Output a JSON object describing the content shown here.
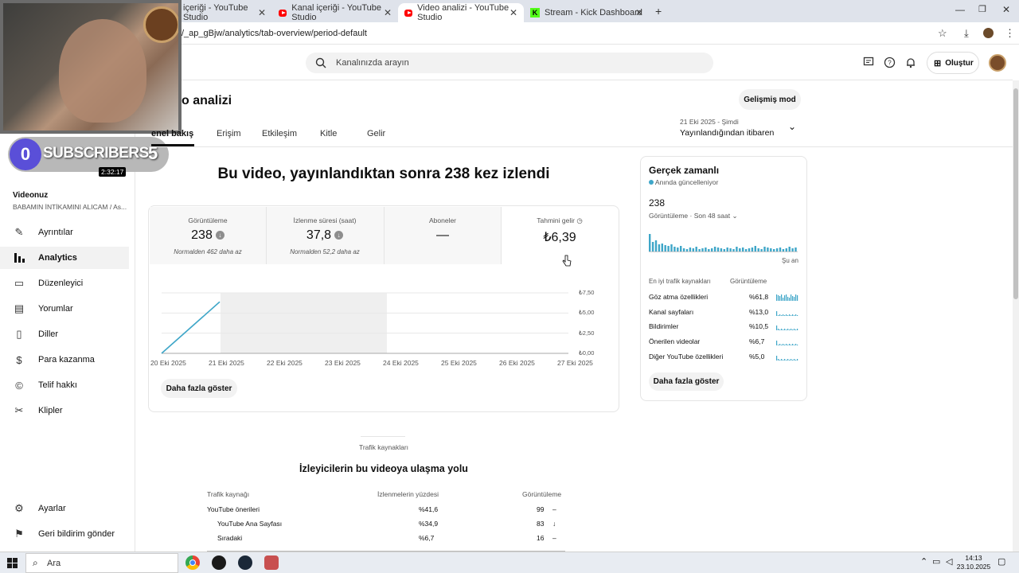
{
  "browser": {
    "tabs": [
      {
        "label": "içeriği - YouTube Studio"
      },
      {
        "label": "Kanal içeriği - YouTube Studio"
      },
      {
        "label": "Video analizi - YouTube Studio"
      },
      {
        "label": "Stream - Kick Dashboard"
      }
    ],
    "url": "/_ap_gBjw/analytics/tab-overview/period-default"
  },
  "header": {
    "search_placeholder": "Kanalınızda arayın",
    "create_label": "Oluştur"
  },
  "overlay": {
    "subscribers_left": "0",
    "subscribers_text": "SUBSCRIBERS",
    "subscribers_right": "5",
    "video_duration": "2:32:17"
  },
  "sidebar": {
    "your_video": "Videonuz",
    "video_title": "BABAMIN İNTİKAMINI ALICAM / As...",
    "items": [
      {
        "label": "Ayrıntılar",
        "icon": "pencil-icon"
      },
      {
        "label": "Analytics",
        "icon": "analytics-icon"
      },
      {
        "label": "Düzenleyici",
        "icon": "editor-icon"
      },
      {
        "label": "Yorumlar",
        "icon": "comments-icon"
      },
      {
        "label": "Diller",
        "icon": "languages-icon"
      },
      {
        "label": "Para kazanma",
        "icon": "dollar-icon"
      },
      {
        "label": "Telif hakkı",
        "icon": "copyright-icon"
      },
      {
        "label": "Klipler",
        "icon": "scissors-icon"
      }
    ],
    "settings": "Ayarlar",
    "feedback": "Geri bildirim gönder"
  },
  "page": {
    "title": "o analizi",
    "advanced_mode": "Gelişmiş mod",
    "tabs": [
      "enel bakış",
      "Erişim",
      "Etkileşim",
      "Kitle",
      "Gelir"
    ],
    "date_range_top": "21 Eki 2025 - Şimdi",
    "date_range_bottom": "Yayınlandığından itibaren",
    "headline": "Bu video, yayınlandıktan sonra 238 kez izlendi",
    "show_more": "Daha fazla göster"
  },
  "metrics": [
    {
      "title": "Görüntüleme",
      "value": "238",
      "sub": "Normalden 462 daha az"
    },
    {
      "title": "İzlenme süresi (saat)",
      "value": "37,8",
      "sub": "Normalden 52,2 daha az"
    },
    {
      "title": "Aboneler",
      "value": "—",
      "sub": ""
    },
    {
      "title": "Tahmini gelir",
      "value": "₺6,39",
      "sub": ""
    }
  ],
  "chart_data": {
    "type": "line",
    "x": [
      "20 Eki 2025",
      "21 Eki 2025",
      "22 Eki 2025",
      "23 Eki 2025",
      "24 Eki 2025",
      "25 Eki 2025",
      "26 Eki 2025",
      "27 Eki 2025"
    ],
    "series": [
      {
        "values": [
          0,
          6.39
        ]
      }
    ],
    "x_points": [
      "20 Eki 2025",
      "21 Eki 2025"
    ],
    "y_ticks": [
      "₺7,50",
      "₺5,00",
      "₺2,50",
      "₺0,00"
    ],
    "ylim": [
      0,
      7.5
    ],
    "highlight_range": [
      "21 Eki 2025",
      "24 Eki 2025"
    ],
    "color": "#3ea6c8"
  },
  "realtime": {
    "title": "Gerçek zamanlı",
    "subtitle": "Anında güncelleniyor",
    "value": "238",
    "caption": "Görüntüleme · Son 48 saat",
    "now_label": "Şu an",
    "sources_header_left": "En iyi trafik kaynakları",
    "sources_header_right": "Görüntüleme",
    "sources": [
      {
        "name": "Göz atma özellikleri",
        "pct": "%61,8"
      },
      {
        "name": "Kanal sayfaları",
        "pct": "%13,0"
      },
      {
        "name": "Bildirimler",
        "pct": "%10,5"
      },
      {
        "name": "Önerilen videolar",
        "pct": "%6,7"
      },
      {
        "name": "Diğer YouTube özellikleri",
        "pct": "%5,0"
      }
    ],
    "show_more": "Daha fazla göster"
  },
  "traffic": {
    "tab_label": "Trafik kaynakları",
    "title": "İzleyicilerin bu videoya ulaşma yolu",
    "col_source": "Trafik kaynağı",
    "col_pct": "İzlenmelerin yüzdesi",
    "col_views": "Görüntüleme",
    "rows": [
      {
        "source": "YouTube önerileri",
        "pct": "%41,6",
        "views": "99",
        "trend": "–"
      },
      {
        "source": "YouTube Ana Sayfası",
        "pct": "%34,9",
        "views": "83",
        "trend": "↓"
      },
      {
        "source": "Sıradaki",
        "pct": "%6,7",
        "views": "16",
        "trend": "–"
      }
    ]
  },
  "taskbar": {
    "search": "Ara",
    "time": "14:13",
    "date": "23.10.2025"
  }
}
